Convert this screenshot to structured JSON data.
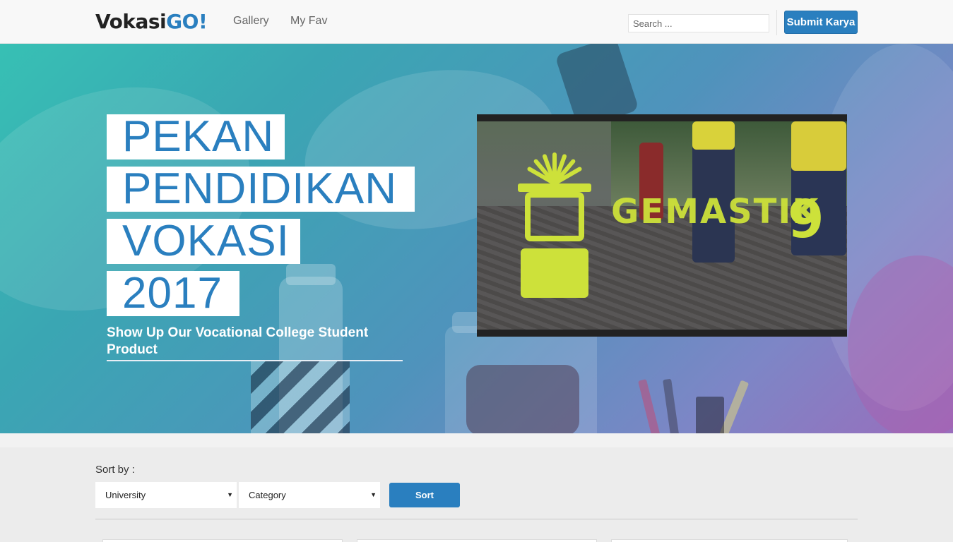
{
  "navbar": {
    "brand_main": "Vokasi",
    "brand_accent": "GO!",
    "links": [
      {
        "label": "Gallery"
      },
      {
        "label": "My Fav"
      }
    ],
    "search": {
      "placeholder": "Search ..."
    },
    "submit_label": "Submit Karya"
  },
  "hero": {
    "title_lines": [
      "PEKAN",
      "PENDIDIKAN",
      "VOKASI",
      "2017"
    ],
    "tagline": "Show Up Our Vocational College Student Product",
    "video": {
      "overlay_text": "GEMASTIK",
      "overlay_number": "9"
    }
  },
  "sort": {
    "label": "Sort by :",
    "university": {
      "selected": "University"
    },
    "category": {
      "selected": "Category"
    },
    "button_label": "Sort"
  },
  "colors": {
    "accent": "#2a7fbf",
    "navbar_bg": "#f8f8f8",
    "page_bg": "#ececec",
    "logo_green": "#cde13a"
  }
}
